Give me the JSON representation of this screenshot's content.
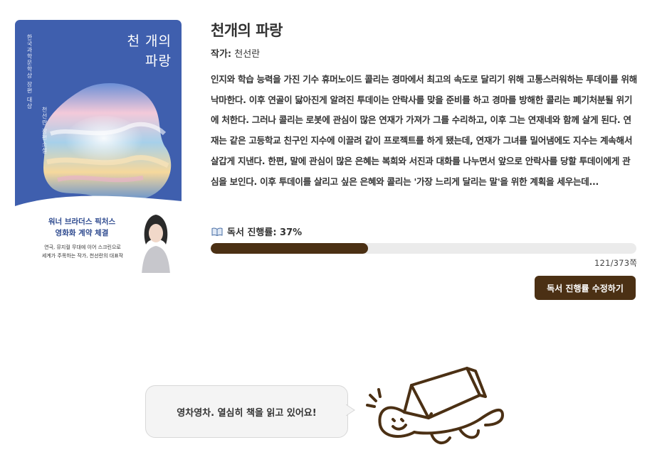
{
  "book": {
    "title": "천개의 파랑",
    "author_label": "작가:",
    "author": "천선란",
    "summary": "인지와 학습 능력을 가진 기수 휴머노이드 콜리는 경마에서 최고의 속도로 달리기 위해 고통스러워하는 투데이를 위해 낙마한다. 이후 연골이 닳아진게 알려진 투데이는 안락사를 맞을 준비를 하고 경마를 방해한 콜리는 폐기처분될 위기에 처한다. 그러나 콜리는 로봇에 관심이 많은 연재가 가져가 그를 수리하고, 이후 그는 연재네와 함께 살게 된다. 연재는 같은 고등학교 친구인 지수에 이끌려 같이 프로젝트를 하게 됐는데, 연재가 그녀를 밀어냄에도 지수는 계속해서 살갑게 지낸다. 한편, 말에 관심이 많은 은혜는 복희와 서진과 대화를 나누면서 앞으로 안락사를 당할 투데이에게 관심을 보인다. 이후 투데이를 살리고 싶은 은혜와 콜리는 '가장 느리게 달리는 말'을 위한 계획을 세우는데..."
  },
  "cover": {
    "title_line1": "천 개의",
    "title_line2": "파랑",
    "award_text": "한국과학문학상 장편 대상",
    "author_text": "천선란 장편소설",
    "headline_line1": "워너 브라더스 픽처스",
    "headline_line2": "영화화 계약 체결",
    "sub_line1": "연극, 뮤지컬 무대에 이어 스크린으로",
    "sub_line2": "세계가 주목하는 작가, 천선란의 대표작",
    "colors": {
      "background": "#3f5fae",
      "band": "#ffffff"
    }
  },
  "progress": {
    "icon": "open-book-icon",
    "label": "독서 진행률: 37%",
    "percent": 37,
    "pages_text": "121/373쪽",
    "current_page": 121,
    "total_pages": 373,
    "edit_button": "독서 진행률 수정하기"
  },
  "mascot": {
    "icon": "turtle-reading-icon",
    "message": "영차영차. 열심히 책을 읽고 있어요!"
  },
  "theme": {
    "accent": "#4b3014",
    "track": "#ebebeb",
    "bubble_bg": "#f4f4f4"
  }
}
